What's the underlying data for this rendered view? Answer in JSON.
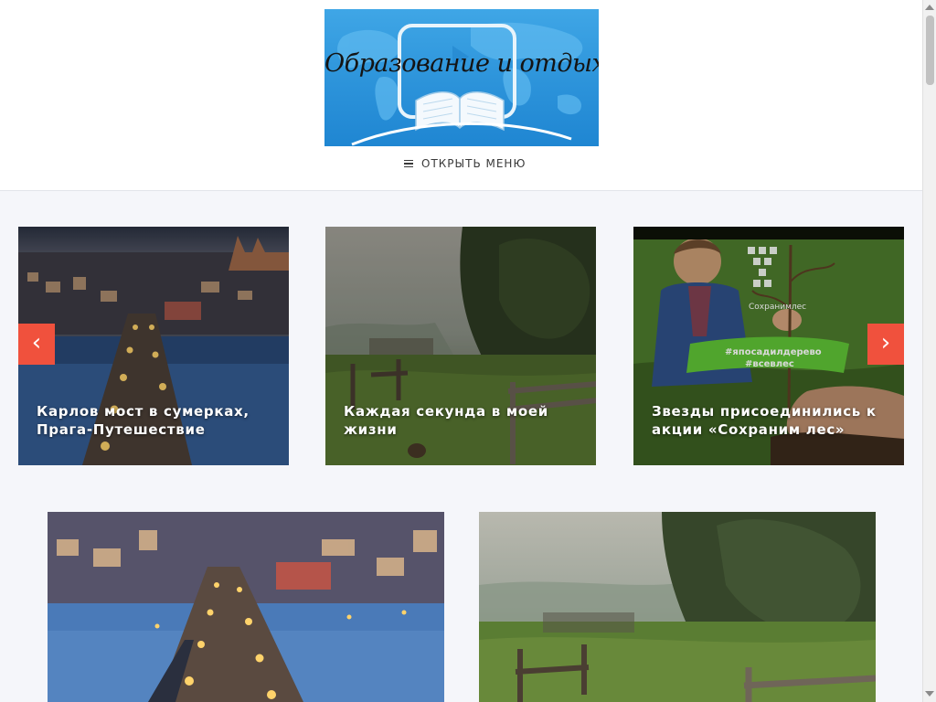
{
  "site": {
    "logo_text": "Образование и отдых"
  },
  "menu": {
    "toggle_label": "ОТКРЫТЬ МЕНЮ"
  },
  "slider": {
    "prev_arrow": "‹",
    "next_arrow": "›",
    "slides": [
      {
        "title": "Карлов мост в сумерках, Прага-Путешествие"
      },
      {
        "title": "Каждая секунда в моей жизни"
      },
      {
        "title": "Звезды присоединились к акции «Сохраним лес»"
      }
    ],
    "slide3_badge": {
      "brand": "Сохранимлес",
      "hashtags": [
        "#япосадилдерево",
        "#всевлес"
      ]
    }
  },
  "cards": [
    {
      "image": "prague-charles-bridge-dusk"
    },
    {
      "image": "misty-forest-fence"
    }
  ],
  "colors": {
    "accent": "#f0513d",
    "logo_blue": "#2c93da",
    "background": "#f5f6fa"
  }
}
